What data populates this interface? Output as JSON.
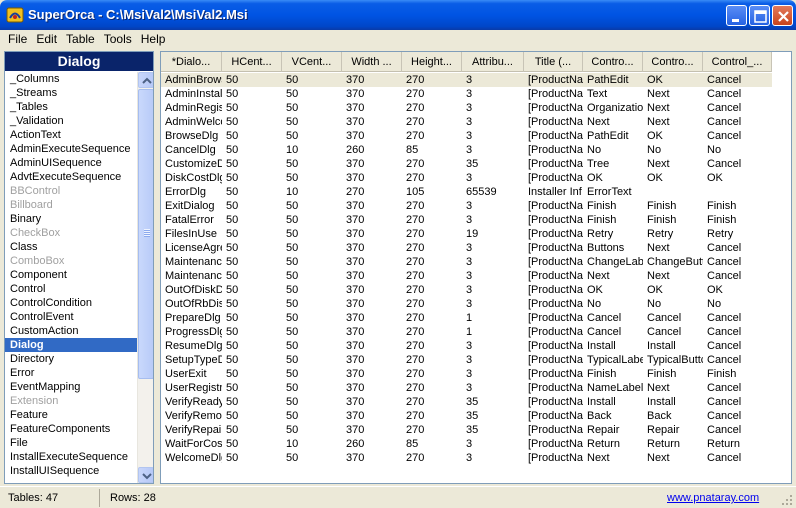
{
  "window": {
    "title": "SuperOrca - C:\\MsiVal2\\MsiVal2.Msi"
  },
  "menu": [
    "File",
    "Edit",
    "Table",
    "Tools",
    "Help"
  ],
  "left_pane": {
    "header": "Dialog",
    "tables": [
      {
        "name": "_Columns",
        "grey": false
      },
      {
        "name": "_Streams",
        "grey": false
      },
      {
        "name": "_Tables",
        "grey": false
      },
      {
        "name": "_Validation",
        "grey": false
      },
      {
        "name": "ActionText",
        "grey": false
      },
      {
        "name": "AdminExecuteSequence",
        "grey": false
      },
      {
        "name": "AdminUISequence",
        "grey": false
      },
      {
        "name": "AdvtExecuteSequence",
        "grey": false
      },
      {
        "name": "BBControl",
        "grey": true
      },
      {
        "name": "Billboard",
        "grey": true
      },
      {
        "name": "Binary",
        "grey": false
      },
      {
        "name": "CheckBox",
        "grey": true
      },
      {
        "name": "Class",
        "grey": false
      },
      {
        "name": "ComboBox",
        "grey": true
      },
      {
        "name": "Component",
        "grey": false
      },
      {
        "name": "Control",
        "grey": false
      },
      {
        "name": "ControlCondition",
        "grey": false
      },
      {
        "name": "ControlEvent",
        "grey": false
      },
      {
        "name": "CustomAction",
        "grey": false
      },
      {
        "name": "Dialog",
        "grey": false,
        "selected": true
      },
      {
        "name": "Directory",
        "grey": false
      },
      {
        "name": "Error",
        "grey": false
      },
      {
        "name": "EventMapping",
        "grey": false
      },
      {
        "name": "Extension",
        "grey": true
      },
      {
        "name": "Feature",
        "grey": false
      },
      {
        "name": "FeatureComponents",
        "grey": false
      },
      {
        "name": "File",
        "grey": false
      },
      {
        "name": "InstallExecuteSequence",
        "grey": false
      },
      {
        "name": "InstallUISequence",
        "grey": false
      }
    ]
  },
  "grid": {
    "columns": [
      "*Dialo...",
      "HCent...",
      "VCent...",
      "Width ...",
      "Height...",
      "Attribu...",
      "Title (...",
      "Contro...",
      "Contro...",
      "Control_..."
    ],
    "rows": [
      [
        "AdminBrows",
        "50",
        "50",
        "370",
        "270",
        "3",
        "[ProductNar",
        "PathEdit",
        "OK",
        "Cancel"
      ],
      [
        "AdminInstal",
        "50",
        "50",
        "370",
        "270",
        "3",
        "[ProductNar",
        "Text",
        "Next",
        "Cancel"
      ],
      [
        "AdminRegist",
        "50",
        "50",
        "370",
        "270",
        "3",
        "[ProductNar",
        "Organization",
        "Next",
        "Cancel"
      ],
      [
        "AdminWelco",
        "50",
        "50",
        "370",
        "270",
        "3",
        "[ProductNar",
        "Next",
        "Next",
        "Cancel"
      ],
      [
        "BrowseDlg",
        "50",
        "50",
        "370",
        "270",
        "3",
        "[ProductNar",
        "PathEdit",
        "OK",
        "Cancel"
      ],
      [
        "CancelDlg",
        "50",
        "10",
        "260",
        "85",
        "3",
        "[ProductNar",
        "No",
        "No",
        "No"
      ],
      [
        "CustomizeD",
        "50",
        "50",
        "370",
        "270",
        "35",
        "[ProductNar",
        "Tree",
        "Next",
        "Cancel"
      ],
      [
        "DiskCostDlg",
        "50",
        "50",
        "370",
        "270",
        "3",
        "[ProductNar",
        "OK",
        "OK",
        "OK"
      ],
      [
        "ErrorDlg",
        "50",
        "10",
        "270",
        "105",
        "65539",
        "Installer Inf",
        "ErrorText",
        "",
        ""
      ],
      [
        "ExitDialog",
        "50",
        "50",
        "370",
        "270",
        "3",
        "[ProductNar",
        "Finish",
        "Finish",
        "Finish"
      ],
      [
        "FatalError",
        "50",
        "50",
        "370",
        "270",
        "3",
        "[ProductNar",
        "Finish",
        "Finish",
        "Finish"
      ],
      [
        "FilesInUse",
        "50",
        "50",
        "370",
        "270",
        "19",
        "[ProductNar",
        "Retry",
        "Retry",
        "Retry"
      ],
      [
        "LicenseAgre",
        "50",
        "50",
        "370",
        "270",
        "3",
        "[ProductNar",
        "Buttons",
        "Next",
        "Cancel"
      ],
      [
        "Maintenanc",
        "50",
        "50",
        "370",
        "270",
        "3",
        "[ProductNar",
        "ChangeLabe",
        "ChangeButt",
        "Cancel"
      ],
      [
        "Maintenanc",
        "50",
        "50",
        "370",
        "270",
        "3",
        "[ProductNar",
        "Next",
        "Next",
        "Cancel"
      ],
      [
        "OutOfDiskD",
        "50",
        "50",
        "370",
        "270",
        "3",
        "[ProductNar",
        "OK",
        "OK",
        "OK"
      ],
      [
        "OutOfRbDis",
        "50",
        "50",
        "370",
        "270",
        "3",
        "[ProductNar",
        "No",
        "No",
        "No"
      ],
      [
        "PrepareDlg",
        "50",
        "50",
        "370",
        "270",
        "1",
        "[ProductNar",
        "Cancel",
        "Cancel",
        "Cancel"
      ],
      [
        "ProgressDlg",
        "50",
        "50",
        "370",
        "270",
        "1",
        "[ProductNar",
        "Cancel",
        "Cancel",
        "Cancel"
      ],
      [
        "ResumeDlg",
        "50",
        "50",
        "370",
        "270",
        "3",
        "[ProductNar",
        "Install",
        "Install",
        "Cancel"
      ],
      [
        "SetupTypeD",
        "50",
        "50",
        "370",
        "270",
        "3",
        "[ProductNar",
        "TypicalLabe",
        "TypicalButtc",
        "Cancel"
      ],
      [
        "UserExit",
        "50",
        "50",
        "370",
        "270",
        "3",
        "[ProductNar",
        "Finish",
        "Finish",
        "Finish"
      ],
      [
        "UserRegistr",
        "50",
        "50",
        "370",
        "270",
        "3",
        "[ProductNar",
        "NameLabel",
        "Next",
        "Cancel"
      ],
      [
        "VerifyReady",
        "50",
        "50",
        "370",
        "270",
        "35",
        "[ProductNar",
        "Install",
        "Install",
        "Cancel"
      ],
      [
        "VerifyRemo",
        "50",
        "50",
        "370",
        "270",
        "35",
        "[ProductNar",
        "Back",
        "Back",
        "Cancel"
      ],
      [
        "VerifyRepai",
        "50",
        "50",
        "370",
        "270",
        "35",
        "[ProductNar",
        "Repair",
        "Repair",
        "Cancel"
      ],
      [
        "WaitForCos",
        "50",
        "10",
        "260",
        "85",
        "3",
        "[ProductNar",
        "Return",
        "Return",
        "Return"
      ],
      [
        "WelcomeDlg",
        "50",
        "50",
        "370",
        "270",
        "3",
        "[ProductNar",
        "Next",
        "Next",
        "Cancel"
      ]
    ]
  },
  "status": {
    "tables": "Tables: 47",
    "rows": "Rows: 28",
    "link": "www.pnataray.com"
  }
}
